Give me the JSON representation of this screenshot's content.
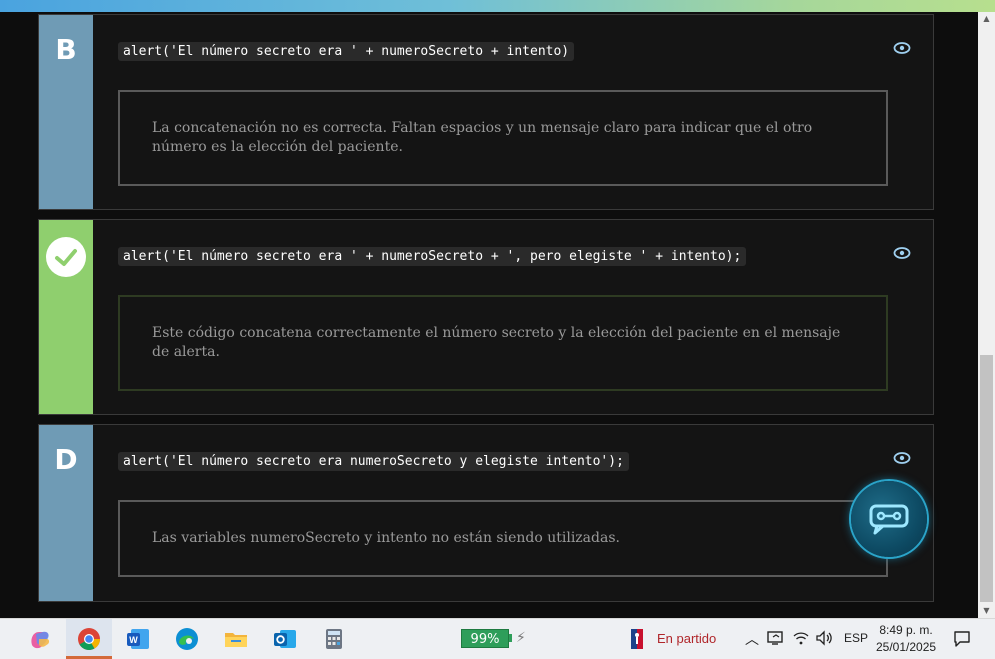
{
  "colors": {
    "neutral_side": "#6f9bb5",
    "correct_side": "#8fcf6e",
    "feedback_border": "#5a5a5a",
    "correct_border": "#2e3b22",
    "battery_green": "#2e9e5a",
    "match_red": "#b0262a"
  },
  "options": [
    {
      "letter": "B",
      "code": "alert('El número secreto era ' + numeroSecreto + intento)",
      "feedback": "La concatenación no es correcta. Faltan espacios y un mensaje claro para indicar que el otro número es la elección del paciente.",
      "correct": false
    },
    {
      "letter": "",
      "code": "alert('El número secreto era ' + numeroSecreto + ', pero elegiste ' + intento);",
      "feedback": "Este código concatena correctamente el número secreto y la elección del paciente en el mensaje de alerta.",
      "correct": true
    },
    {
      "letter": "D",
      "code": "alert('El número secreto era numeroSecreto y elegiste intento');",
      "feedback": "Las variables numeroSecreto y intento no están siendo utilizadas.",
      "correct": false
    }
  ],
  "icons": {
    "eye": "eye-icon",
    "check": "checkmark-icon",
    "chatbot": "chatbot-icon"
  },
  "taskbar": {
    "apps": [
      "copilot-icon",
      "chrome-icon",
      "word-icon",
      "edge-icon",
      "file-explorer-icon",
      "outlook-icon",
      "calculator-icon"
    ],
    "battery": "99%",
    "match_status": "En partido",
    "language": "ESP",
    "time": "8:49 p. m.",
    "date": "25/01/2025"
  }
}
